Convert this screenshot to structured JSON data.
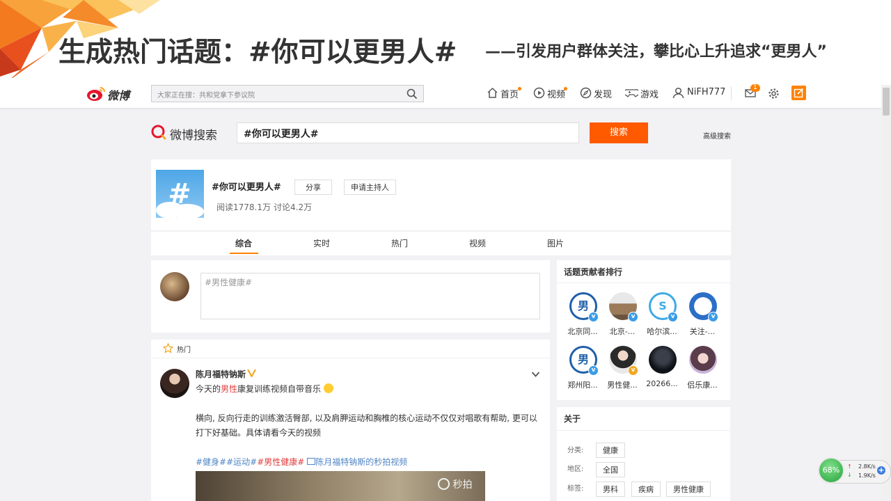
{
  "slide": {
    "title": "生成热门话题：#你可以更男人#",
    "subtitle": "——引发用户群体关注，攀比心上升追求“更男人”"
  },
  "topnav": {
    "logo_text": "微博",
    "search_placeholder": "大家正在搜：共和党拿下参议院",
    "items": [
      {
        "label": "首页",
        "icon": "home-icon"
      },
      {
        "label": "视频",
        "icon": "video-icon"
      },
      {
        "label": "发现",
        "icon": "compass-icon"
      },
      {
        "label": "游戏",
        "icon": "game-icon"
      },
      {
        "label": "NiFH777",
        "icon": "user-icon"
      }
    ],
    "mail_badge": "1"
  },
  "search": {
    "logo_text": "微博搜索",
    "query": "#你可以更男人#",
    "button": "搜索",
    "advanced": "高级搜索"
  },
  "topic": {
    "name": "#你可以更男人#",
    "share_btn": "分享",
    "host_btn": "申请主持人",
    "reads": "阅读1778.1万",
    "discuss": "讨论4.2万"
  },
  "tabs": [
    {
      "label": "综合",
      "active": true
    },
    {
      "label": "实时",
      "active": false
    },
    {
      "label": "热门",
      "active": false
    },
    {
      "label": "视频",
      "active": false
    },
    {
      "label": "图片",
      "active": false
    }
  ],
  "composer": {
    "placeholder": "#男性健康#"
  },
  "hot_section": {
    "label": "热门"
  },
  "post": {
    "author": "陈月福特钠斯",
    "line1_pre": "今天的",
    "line1_hl": "男性",
    "line1_post": "康复训练视频自带音乐",
    "body": "横向, 反向行走的训练激活臀部, 以及肩胛运动和胸椎的核心运动不仅仅对唱歌有帮助, 更可以打下好基础。具体请看今天的视频",
    "tag1": "#健身#",
    "tag2": "#运动#",
    "tag3_hl": "#男性健康#",
    "video_link": "陈月福特钠斯的秒拍视频",
    "watermark": "秒拍"
  },
  "contributors": {
    "title": "话题贡献者排行",
    "items": [
      {
        "name": "北京同..."
      },
      {
        "name": "北京-..."
      },
      {
        "name": "哈尔滨..."
      },
      {
        "name": "关注-..."
      },
      {
        "name": "郑州阳..."
      },
      {
        "name": "男性健..."
      },
      {
        "name": "20266..."
      },
      {
        "name": "侣乐康..."
      }
    ]
  },
  "about": {
    "title": "关于",
    "rows": [
      {
        "label": "分类:",
        "tags": [
          "健康"
        ]
      },
      {
        "label": "地区:",
        "tags": [
          "全国"
        ]
      },
      {
        "label": "标签:",
        "tags": [
          "男科",
          "疾病",
          "男性健康"
        ]
      }
    ]
  },
  "net_widget": {
    "percent": "68%",
    "up": "2.8K/s",
    "down": "1.9K/s"
  },
  "colors": {
    "accent": "#ff8200",
    "search_btn": "#ff5a00",
    "link": "#4f85c6",
    "highlight": "#e23d3d"
  }
}
